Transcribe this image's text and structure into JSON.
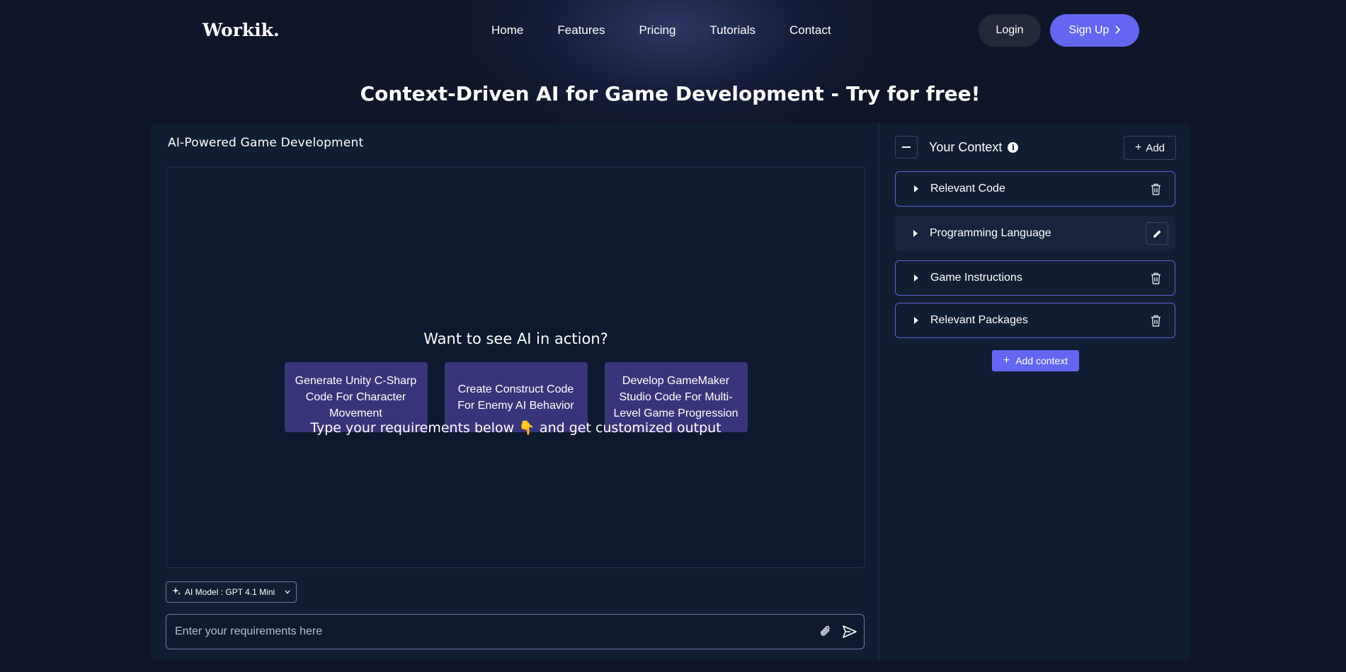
{
  "brand": {
    "logo": "Workik."
  },
  "nav": {
    "items": [
      "Home",
      "Features",
      "Pricing",
      "Tutorials",
      "Contact"
    ],
    "login": "Login",
    "signup": "Sign Up"
  },
  "hero": {
    "title": "Context-Driven AI for Game Development - Try for free!"
  },
  "workspace": {
    "title": "AI-Powered Game Development",
    "see_ai": "Want to see AI in action?",
    "suggestions": [
      "Generate Unity C-Sharp Code For Character Movement",
      "Create Construct Code For Enemy AI Behavior",
      "Develop GameMaker Studio Code For Multi-Level Game Progression"
    ],
    "hint_before": "Type your requirements below",
    "hint_emoji": "👇",
    "hint_after": "and get customized output",
    "model_label": "AI Model : GPT 4.1 Mini",
    "input_placeholder": "Enter your requirements here"
  },
  "context": {
    "title": "Your Context",
    "add_label": "Add",
    "items": [
      {
        "label": "Relevant Code",
        "action": "trash-icon"
      },
      {
        "label": "Programming Language",
        "action": "pencil-icon"
      },
      {
        "label": "Game Instructions",
        "action": "trash-icon"
      },
      {
        "label": "Relevant Packages",
        "action": "trash-icon"
      }
    ],
    "add_context_label": "Add context"
  },
  "colors": {
    "background": "#0f1629",
    "card": "#111d33",
    "accent": "#6366f1",
    "suggestion_bg": "#39357a"
  }
}
